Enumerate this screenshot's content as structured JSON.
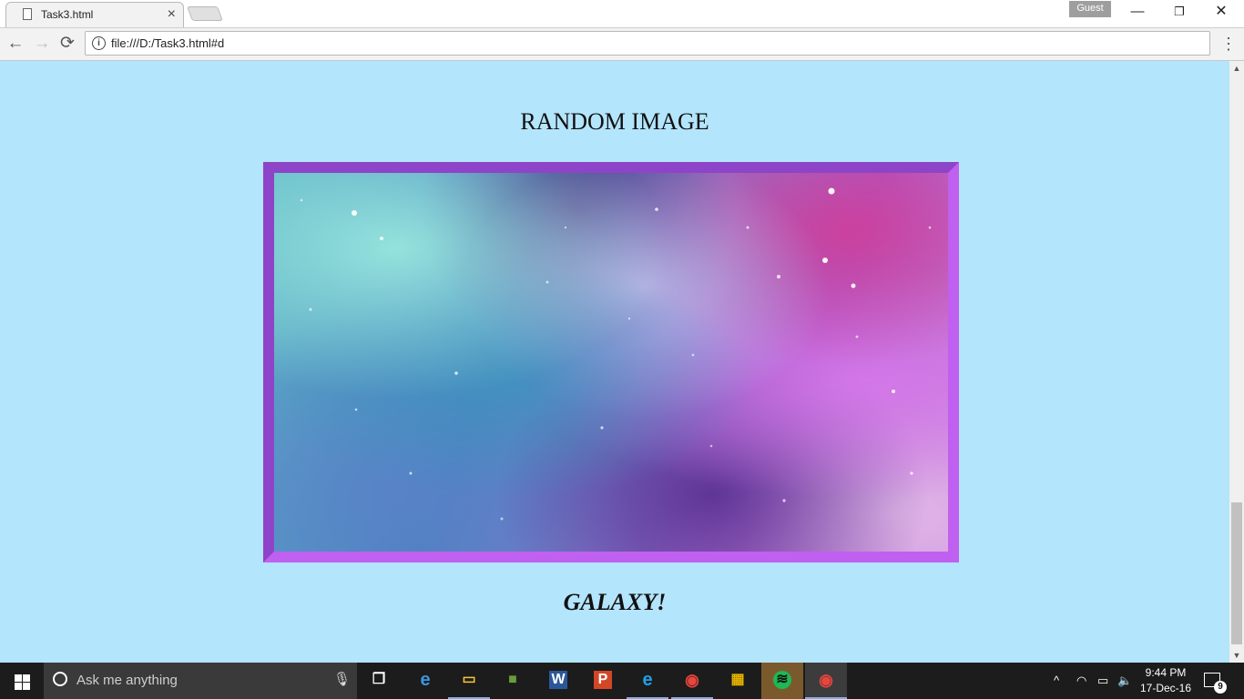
{
  "browser": {
    "tab_title": "Task3.html",
    "tab_close": "×",
    "profile": "Guest",
    "window_controls": {
      "minimize": "—",
      "restore": "❐",
      "close": "✕"
    },
    "nav": {
      "back": "←",
      "forward": "→",
      "reload": "⟳"
    },
    "url": "file:///D:/Task3.html#d",
    "menu": "⋮"
  },
  "page": {
    "heading": "RANDOM IMAGE",
    "caption": "GALAXY!",
    "frame_colors": {
      "dark": "#8e44c8",
      "light": "#c060f0"
    },
    "background": "#b3e5fc"
  },
  "scrollbar": {
    "up": "▲",
    "down": "▼",
    "scroll_position": 0.78
  },
  "taskbar": {
    "search_placeholder": "Ask me anything",
    "mic": "🎙",
    "apps": [
      {
        "name": "task-view-icon",
        "glyph": "❐"
      },
      {
        "name": "edge-icon",
        "glyph": "e"
      },
      {
        "name": "file-explorer-icon",
        "glyph": "▭"
      },
      {
        "name": "minecraft-icon",
        "glyph": "■"
      },
      {
        "name": "word-icon",
        "glyph": "W"
      },
      {
        "name": "powerpoint-icon",
        "glyph": "P"
      },
      {
        "name": "internet-explorer-icon",
        "glyph": "e"
      },
      {
        "name": "chrome-icon",
        "glyph": "◉"
      },
      {
        "name": "store-icon",
        "glyph": "▦"
      },
      {
        "name": "spotify-icon",
        "glyph": "≋"
      },
      {
        "name": "chrome-active-icon",
        "glyph": "◉"
      }
    ],
    "tray": {
      "chevron": "^",
      "wifi": "◠",
      "battery": "▭",
      "volume": "🔈"
    },
    "time": "9:44 PM",
    "date": "17-Dec-16",
    "notifications": "9"
  }
}
